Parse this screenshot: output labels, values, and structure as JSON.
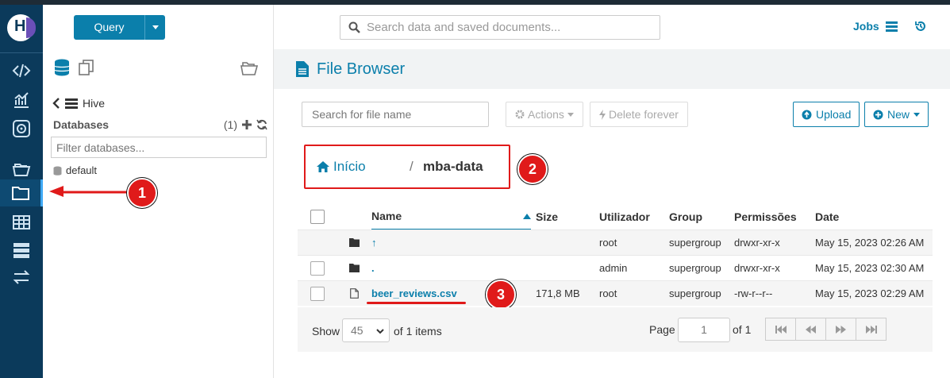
{
  "topbar": {
    "query_label": "Query",
    "search_placeholder": "Search data and saved documents...",
    "jobs_label": "Jobs"
  },
  "assist": {
    "source_label": "Hive",
    "databases_label": "Databases",
    "databases_count": "(1)",
    "filter_placeholder": "Filter databases...",
    "databases": [
      "default"
    ]
  },
  "page": {
    "title": "File Browser",
    "search_placeholder": "Search for file name",
    "actions_label": "Actions",
    "delete_label": "Delete forever",
    "upload_label": "Upload",
    "new_label": "New"
  },
  "breadcrumb": {
    "home_label": "Início",
    "separator": "/",
    "current_dir": "mba-data"
  },
  "table": {
    "headers": [
      "Name",
      "Size",
      "Utilizador",
      "Group",
      "Permissões",
      "Date"
    ],
    "rows": [
      {
        "icon": "folder-icon",
        "name": "↑",
        "size": "",
        "user": "root",
        "group": "supergroup",
        "perms": "drwxr-xr-x",
        "date": "May 15, 2023 02:26 AM"
      },
      {
        "icon": "folder-icon",
        "name": ".",
        "size": "",
        "user": "admin",
        "group": "supergroup",
        "perms": "drwxr-xr-x",
        "date": "May 15, 2023 02:30 AM"
      },
      {
        "icon": "file-icon",
        "name": "beer_reviews.csv",
        "size": "171,8 MB",
        "user": "root",
        "group": "supergroup",
        "perms": "-rw-r--r--",
        "date": "May 15, 2023 02:29 AM"
      }
    ]
  },
  "pager": {
    "show_label": "Show",
    "page_size": "45",
    "items_label": "of 1 items",
    "page_label": "Page",
    "page_value": "1",
    "of_pages": "of 1"
  },
  "annotations": {
    "badge1": "1",
    "badge2": "2",
    "badge3": "3"
  },
  "colors": {
    "accent": "#0b7fab",
    "rail": "#0b3a5b",
    "annotation_red": "#e01a1a"
  }
}
